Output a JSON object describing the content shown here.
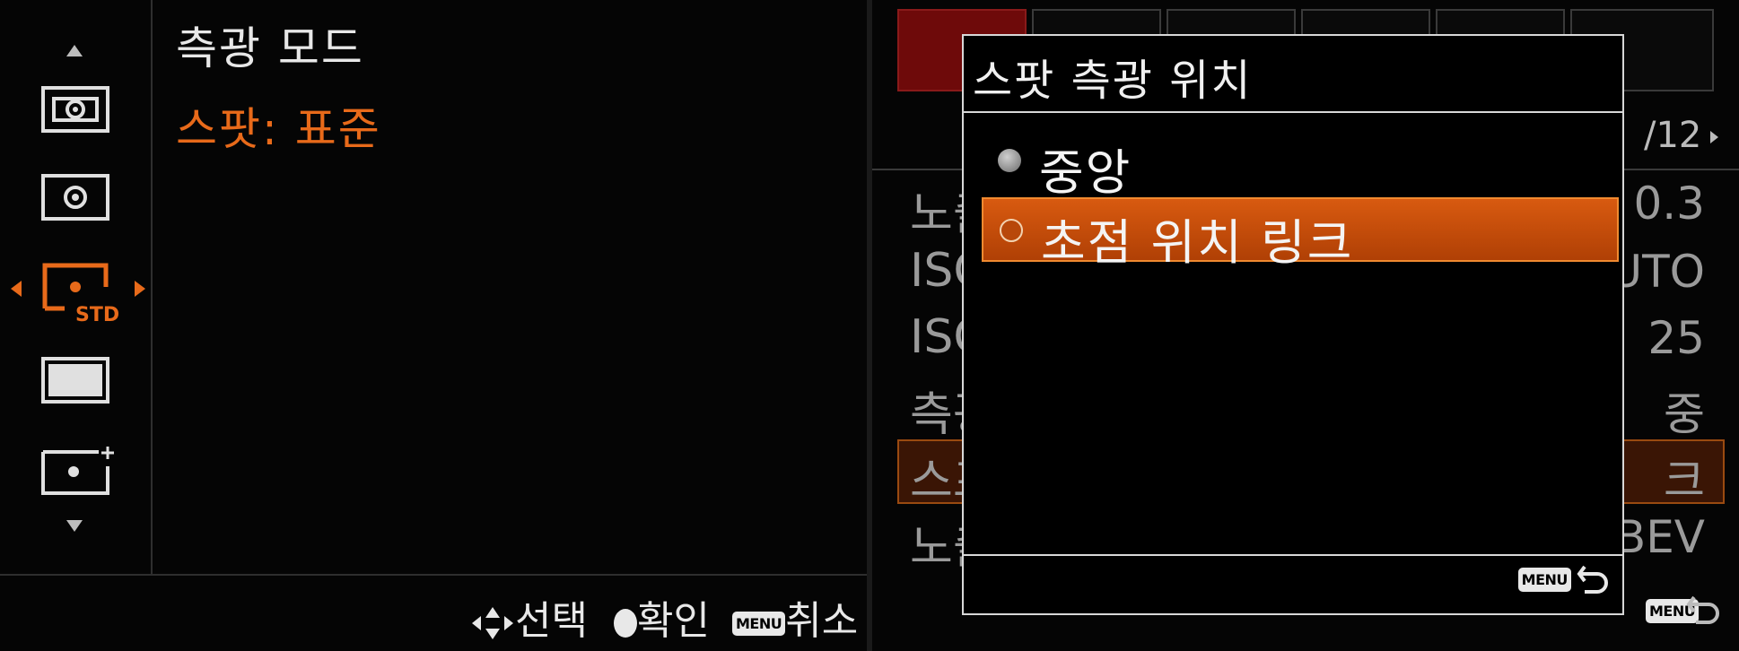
{
  "left_panel": {
    "setting_title": "측광 모드",
    "setting_value": "스팟: 표준",
    "mode_icons": [
      {
        "name": "multi-metering-icon",
        "selected": false
      },
      {
        "name": "center-metering-icon",
        "selected": false
      },
      {
        "name": "spot-standard-icon",
        "selected": true,
        "badge": "STD"
      },
      {
        "name": "entire-screen-avg-icon",
        "selected": false
      },
      {
        "name": "highlight-metering-icon",
        "selected": false
      }
    ],
    "hints": {
      "select": "선택",
      "confirm": "확인",
      "menu_badge": "MENU",
      "cancel": "취소"
    }
  },
  "right_panel": {
    "page_indicator": "/12",
    "background_rows": [
      {
        "label": "노출",
        "value": "0.3"
      },
      {
        "label": "ISO",
        "value": "UTO"
      },
      {
        "label": "ISO",
        "value": "25"
      },
      {
        "label": "측광",
        "value": "중"
      },
      {
        "label": "스프",
        "value": "크"
      },
      {
        "label": "노출",
        "value": "BEV"
      }
    ],
    "menu_badge": "MENU",
    "dialog": {
      "title": "스팟 측광 위치",
      "options": [
        {
          "label": "중앙",
          "selected": false
        },
        {
          "label": "초점 위치 링크",
          "selected": true
        }
      ],
      "menu_badge": "MENU"
    }
  },
  "colors": {
    "accent_orange": "#e86a1a",
    "active_tab_red": "#6e0a0a",
    "text": "#e8e8e8",
    "background": "#050505"
  }
}
